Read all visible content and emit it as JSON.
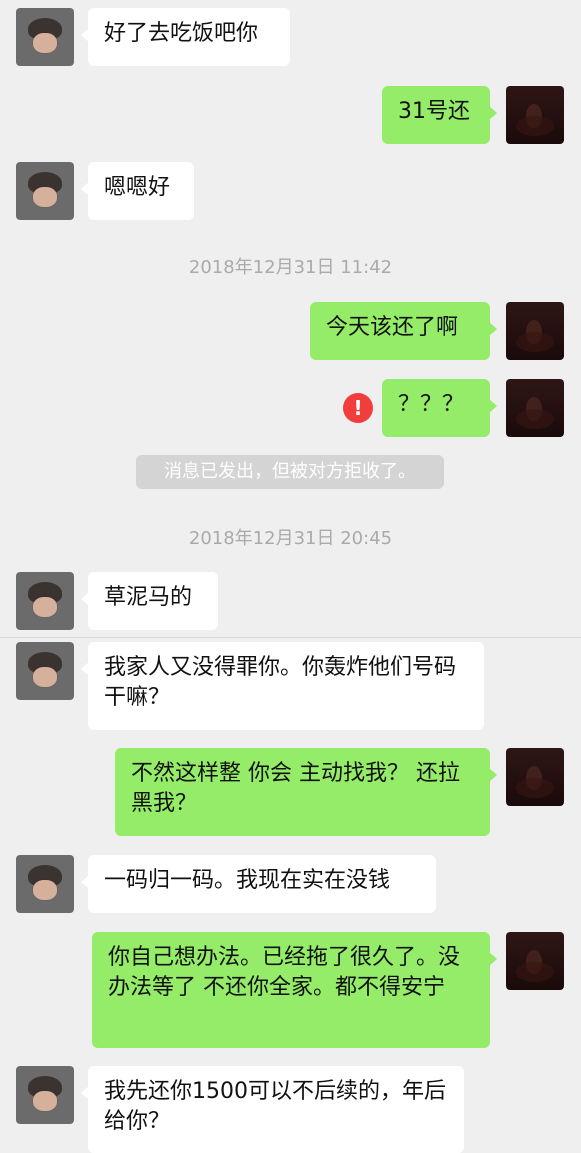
{
  "messages": [
    {
      "text": "好了去吃饭吧你"
    },
    {
      "text": "31号还"
    },
    {
      "text": "嗯嗯好"
    },
    {
      "text": "2018年12月31日 11:42"
    },
    {
      "text": "今天该还了啊"
    },
    {
      "text": "？？？"
    },
    {
      "text": "消息已发出，但被对方拒收了。"
    },
    {
      "text": "2018年12月31日 20:45"
    },
    {
      "text": "草泥马的"
    },
    {
      "text": "我家人又没得罪你。你轰炸他们号码干嘛？"
    },
    {
      "text": "不然这样整 你会 主动找我？ 还拉黑我？"
    },
    {
      "text": "一码归一码。我现在实在没钱"
    },
    {
      "text": "你自己想办法。已经拖了很久了。没办法等了 不还你全家。都不得安宁"
    },
    {
      "text": "我先还你1500可以不后续的，年后给你？"
    }
  ],
  "icons": {
    "error": "!"
  },
  "colors": {
    "background": "#efefef",
    "incoming_bubble": "#ffffff",
    "outgoing_bubble": "#95ec69",
    "timestamp": "#aaaaaa",
    "system_bg": "#d4d4d4",
    "error_red": "#f23d3d"
  }
}
